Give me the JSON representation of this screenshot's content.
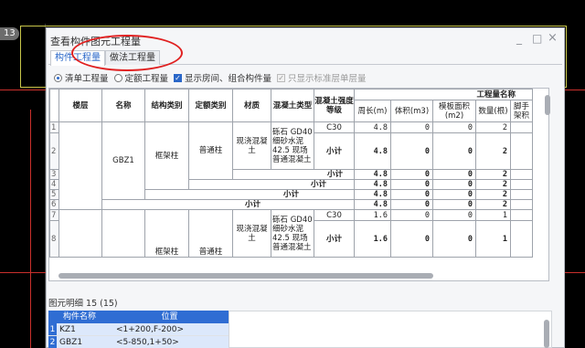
{
  "background": {
    "badge": "13"
  },
  "dialog": {
    "title": "查看构件图元工程量",
    "tabs": [
      "构件工程量",
      "做法工程量"
    ],
    "window_controls": {
      "minimize": "_",
      "maximize": "□",
      "close": "×"
    }
  },
  "options": {
    "radio1": "清单工程量",
    "radio2": "定额工程量",
    "check1": "显示房间、组合构件量",
    "check2": "只显示标准层单层量"
  },
  "table": {
    "headers": {
      "floor": "楼层",
      "name": "名称",
      "struct": "结构类别",
      "quota": "定额类别",
      "material": "材质",
      "concrete_type": "混凝土类型",
      "concrete_grade": "混凝土强度等级",
      "group": "工程量名称",
      "perimeter": "周长(m)",
      "volume": "体积(m3)",
      "formwork": "模板面积(m2)",
      "count": "数量(根)",
      "scaffold": "脚手架积"
    },
    "rows": [
      {
        "n": "1",
        "concrete": "砾石 GD40 细砂水泥42.5 现场普通混凝土",
        "grade": "C30",
        "perimeter": "4.8",
        "volume": "0",
        "formwork": "0",
        "count": "2"
      },
      {
        "n": "2",
        "name": "GBZ1",
        "struct": "框架柱",
        "quota": "普通柱",
        "material": "现浇混凝土",
        "grade": "小计",
        "perimeter": "4.8",
        "volume": "0",
        "formwork": "0",
        "count": "2"
      },
      {
        "n": "3",
        "label": "小计",
        "perimeter": "4.8",
        "volume": "0",
        "formwork": "0",
        "count": "2"
      },
      {
        "n": "4",
        "label": "小计",
        "perimeter": "4.8",
        "volume": "0",
        "formwork": "0",
        "count": "2"
      },
      {
        "n": "5",
        "label": "小计",
        "perimeter": "4.8",
        "volume": "0",
        "formwork": "0",
        "count": "2"
      },
      {
        "n": "6",
        "label": "小计",
        "perimeter": "4.8",
        "volume": "0",
        "formwork": "0",
        "count": "2"
      },
      {
        "n": "7",
        "concrete": "砾石 GD40 细砂水泥42.5 现场普通混凝土",
        "grade": "C30",
        "perimeter": "1.6",
        "volume": "0",
        "formwork": "0",
        "count": "1"
      },
      {
        "n": "8",
        "struct": "框架柱",
        "quota": "普通柱",
        "material": "现浇混凝土",
        "grade": "小计",
        "perimeter": "1.6",
        "volume": "0",
        "formwork": "0",
        "count": "1"
      }
    ]
  },
  "detail": {
    "label": "图元明细 15 (15)",
    "headers": [
      "构件名称",
      "位置"
    ],
    "rows": [
      {
        "n": "1",
        "name": "KZ1",
        "pos": "<1+200,F-200>"
      },
      {
        "n": "2",
        "name": "GBZ1",
        "pos": "<5-850,1+50>"
      }
    ]
  }
}
